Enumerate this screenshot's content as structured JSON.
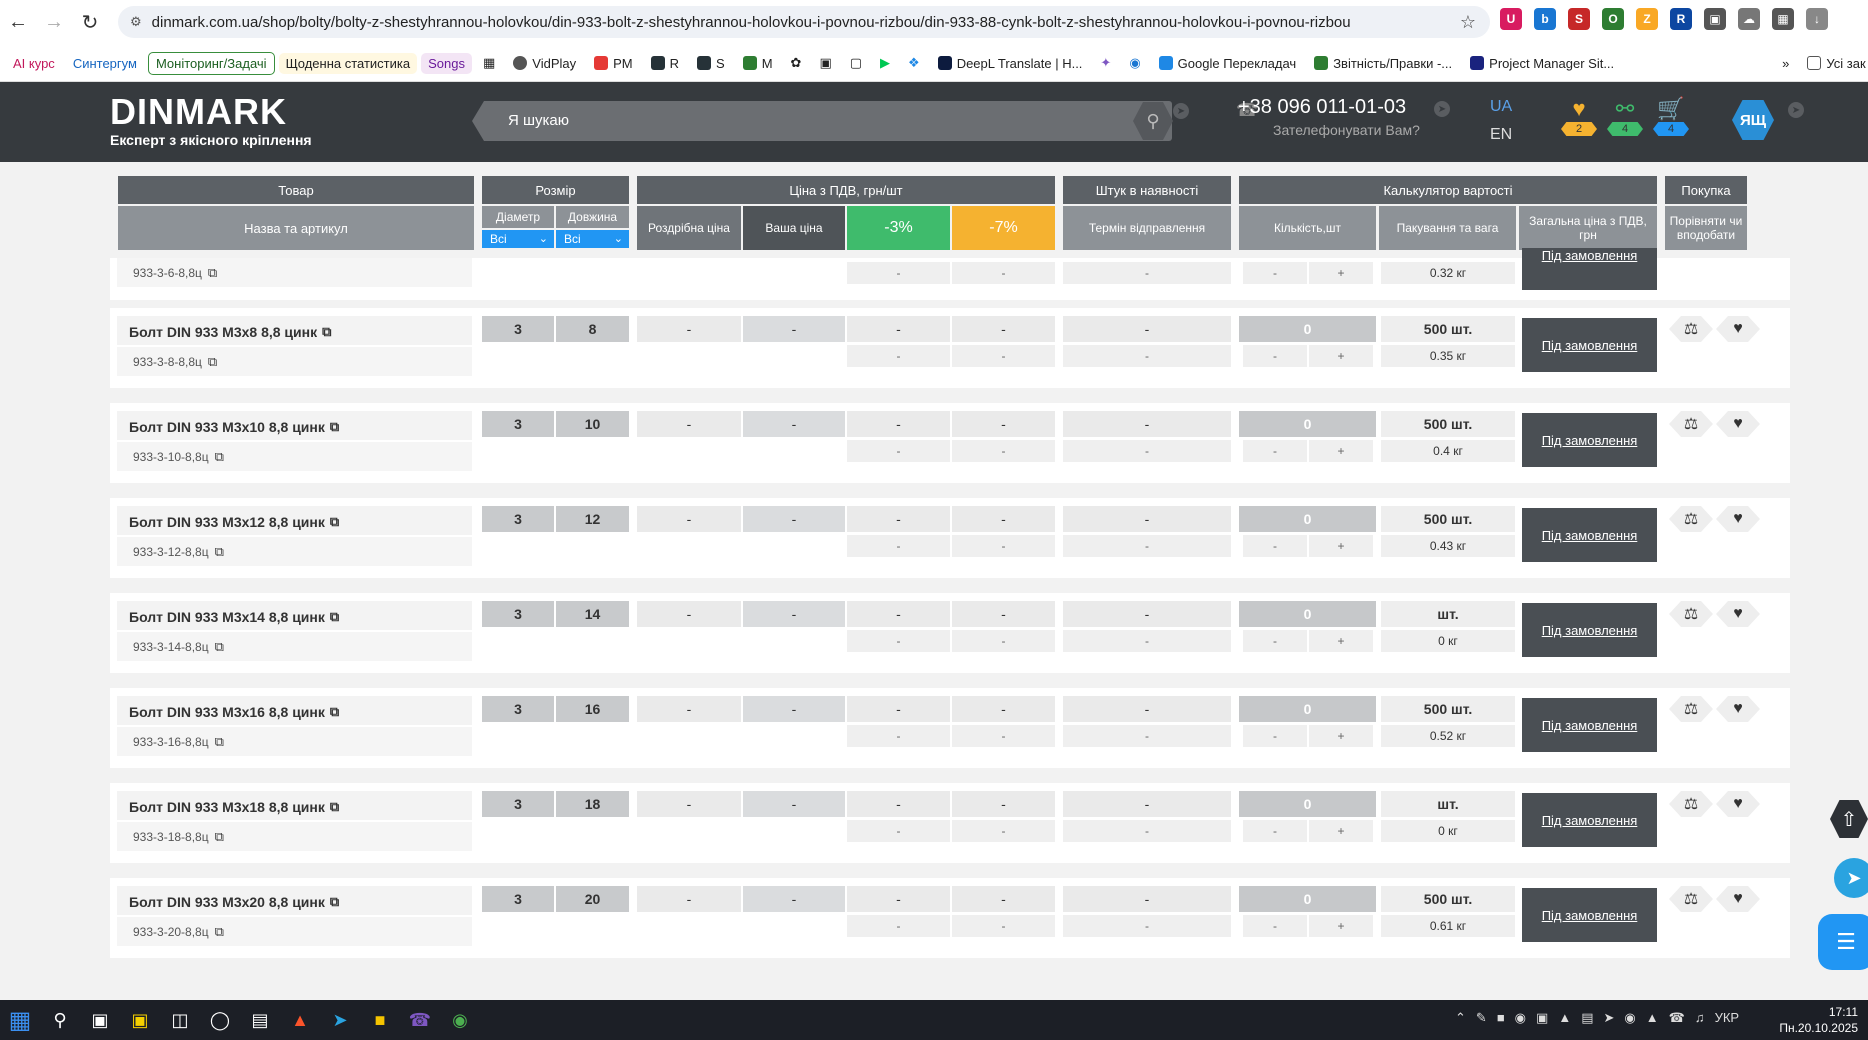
{
  "browser": {
    "url": "dinmark.com.ua/shop/bolty/bolty-z-shestyhrannou-holovkou/din-933-bolt-z-shestyhrannou-holovkou-i-povnou-rizbou/din-933-88-cynk-bolt-z-shestyhrannou-holovkou-i-povnou-rizbou",
    "bookmarks": [
      "AI курс",
      "Синтергум",
      "Моніторинг/Задачі",
      "Щоденна статистика",
      "Songs",
      "VidPlay",
      "PM",
      "R",
      "S",
      "M",
      "DeepL Translate | H...",
      "Google Перекладач",
      "Звітність/Правки -...",
      "Project Manager Sit..."
    ],
    "bookmarks_folder": "Усі зак"
  },
  "header": {
    "logo": "DINMARK",
    "tagline": "Експерт з якісного кріплення",
    "search_placeholder": "Я шукаю",
    "phone": "+38 096 011-01-03",
    "callback": "Зателефонувати Вам?",
    "lang_active": "UA",
    "lang_other": "EN",
    "favorites_count": "2",
    "compare_count": "4",
    "cart_count": "4",
    "avatar": "ЯЩ"
  },
  "table": {
    "group_headers": {
      "product": "Товар",
      "size": "Розмір",
      "price": "Ціна з ПДВ, грн/шт",
      "stock": "Штук в наявності",
      "calc": "Калькулятор вартості",
      "buy": "Покупка"
    },
    "sub_headers": {
      "name": "Назва та артикул",
      "diameter": "Діаметр",
      "length": "Довжина",
      "retail": "Роздрібна ціна",
      "your_price": "Ваша ціна",
      "disc3": "-3%",
      "disc7": "-7%",
      "ship_term": "Термін відправлення",
      "qty": "Кількість,шт",
      "pack": "Пакування та вага",
      "total": "Загальна ціна з ПДВ, грн",
      "compare": "Порівняти чи вподобати"
    },
    "filter_diameter": "Всі",
    "filter_length": "Всі",
    "partial_row": {
      "sku": "933-3-6-8,8ц",
      "weight": "0.32 кг",
      "order": "Під замовлення"
    },
    "rows": [
      {
        "name": "Болт DIN 933 M3x8 8,8 цинк",
        "sku": "933-3-8-8,8ц",
        "d": "3",
        "l": "8",
        "retail": "-",
        "your": "-",
        "p3": "-",
        "p7": "-",
        "p3s": "-",
        "p7s": "-",
        "stock": "-",
        "term": "-",
        "qty": "0",
        "minus": "-",
        "plus": "+",
        "pack": "500 шт.",
        "weight": "0.35 кг",
        "order": "Під замовлення"
      },
      {
        "name": "Болт DIN 933 M3x10 8,8 цинк",
        "sku": "933-3-10-8,8ц",
        "d": "3",
        "l": "10",
        "retail": "-",
        "your": "-",
        "p3": "-",
        "p7": "-",
        "p3s": "-",
        "p7s": "-",
        "stock": "-",
        "term": "-",
        "qty": "0",
        "minus": "-",
        "plus": "+",
        "pack": "500 шт.",
        "weight": "0.4 кг",
        "order": "Під замовлення"
      },
      {
        "name": "Болт DIN 933 M3x12 8,8 цинк",
        "sku": "933-3-12-8,8ц",
        "d": "3",
        "l": "12",
        "retail": "-",
        "your": "-",
        "p3": "-",
        "p7": "-",
        "p3s": "-",
        "p7s": "-",
        "stock": "-",
        "term": "-",
        "qty": "0",
        "minus": "-",
        "plus": "+",
        "pack": "500 шт.",
        "weight": "0.43 кг",
        "order": "Під замовлення"
      },
      {
        "name": "Болт DIN 933 M3x14 8,8 цинк",
        "sku": "933-3-14-8,8ц",
        "d": "3",
        "l": "14",
        "retail": "-",
        "your": "-",
        "p3": "-",
        "p7": "-",
        "p3s": "-",
        "p7s": "-",
        "stock": "-",
        "term": "-",
        "qty": "0",
        "minus": "-",
        "plus": "+",
        "pack": "шт.",
        "weight": "0 кг",
        "order": "Під замовлення"
      },
      {
        "name": "Болт DIN 933 M3x16 8,8 цинк",
        "sku": "933-3-16-8,8ц",
        "d": "3",
        "l": "16",
        "retail": "-",
        "your": "-",
        "p3": "-",
        "p7": "-",
        "p3s": "-",
        "p7s": "-",
        "stock": "-",
        "term": "-",
        "qty": "0",
        "minus": "-",
        "plus": "+",
        "pack": "500 шт.",
        "weight": "0.52 кг",
        "order": "Під замовлення"
      },
      {
        "name": "Болт DIN 933 M3x18 8,8 цинк",
        "sku": "933-3-18-8,8ц",
        "d": "3",
        "l": "18",
        "retail": "-",
        "your": "-",
        "p3": "-",
        "p7": "-",
        "p3s": "-",
        "p7s": "-",
        "stock": "-",
        "term": "-",
        "qty": "0",
        "minus": "-",
        "plus": "+",
        "pack": "шт.",
        "weight": "0 кг",
        "order": "Під замовлення"
      },
      {
        "name": "Болт DIN 933 M3x20 8,8 цинк",
        "sku": "933-3-20-8,8ц",
        "d": "3",
        "l": "20",
        "retail": "-",
        "your": "-",
        "p3": "-",
        "p7": "-",
        "p3s": "-",
        "p7s": "-",
        "stock": "-",
        "term": "-",
        "qty": "0",
        "minus": "-",
        "plus": "+",
        "pack": "500 шт.",
        "weight": "0.61 кг",
        "order": "Під замовлення"
      }
    ]
  },
  "taskbar": {
    "lang": "УКР",
    "time": "17:11",
    "date": "Пн.20.10.2025"
  }
}
